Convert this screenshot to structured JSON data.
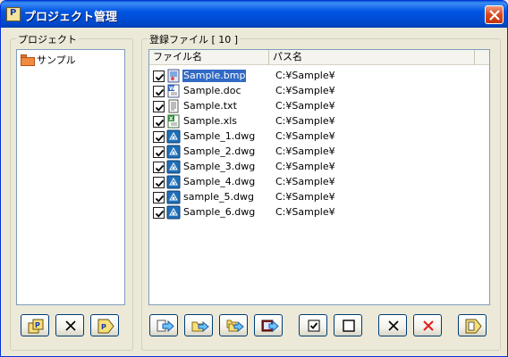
{
  "window": {
    "title": "プロジェクト管理"
  },
  "project_panel": {
    "label": "プロジェクト",
    "items": [
      {
        "label": "サンプル"
      }
    ]
  },
  "files_panel": {
    "label": "登録ファイル [ 10 ]",
    "columns": {
      "name": "ファイル名",
      "path": "パス名"
    },
    "rows": [
      {
        "name": "Sample.bmp",
        "path": "C:¥Sample¥",
        "checked": true,
        "icon": "bmp-file-icon",
        "selected": true
      },
      {
        "name": "Sample.doc",
        "path": "C:¥Sample¥",
        "checked": true,
        "icon": "word-file-icon"
      },
      {
        "name": "Sample.txt",
        "path": "C:¥Sample¥",
        "checked": true,
        "icon": "text-file-icon"
      },
      {
        "name": "Sample.xls",
        "path": "C:¥Sample¥",
        "checked": true,
        "icon": "excel-file-icon"
      },
      {
        "name": "Sample_1.dwg",
        "path": "C:¥Sample¥",
        "checked": true,
        "icon": "dwg-file-icon"
      },
      {
        "name": "Sample_2.dwg",
        "path": "C:¥Sample¥",
        "checked": true,
        "icon": "dwg-file-icon"
      },
      {
        "name": "Sample_3.dwg",
        "path": "C:¥Sample¥",
        "checked": true,
        "icon": "dwg-file-icon"
      },
      {
        "name": "Sample_4.dwg",
        "path": "C:¥Sample¥",
        "checked": true,
        "icon": "dwg-file-icon"
      },
      {
        "name": "sample_5.dwg",
        "path": "C:¥Sample¥",
        "checked": true,
        "icon": "dwg-file-icon"
      },
      {
        "name": "Sample_6.dwg",
        "path": "C:¥Sample¥",
        "checked": true,
        "icon": "dwg-file-icon"
      }
    ]
  },
  "icons": {
    "close": "close-icon",
    "project_new": "new-project-icon",
    "project_delete": "delete-icon",
    "project_open": "open-project-icon",
    "file_buttons": [
      "add-file-icon",
      "add-folder-icon",
      "add-subfolder-icon",
      "add-media-icon",
      "check-all-icon",
      "uncheck-all-icon",
      "remove-icon",
      "remove-all-icon",
      "open-file-icon"
    ]
  },
  "colors": {
    "titlebar": "#0054e3",
    "selection": "#316ac5",
    "close": "#d7471c",
    "delete_red": "#e81a1a"
  }
}
